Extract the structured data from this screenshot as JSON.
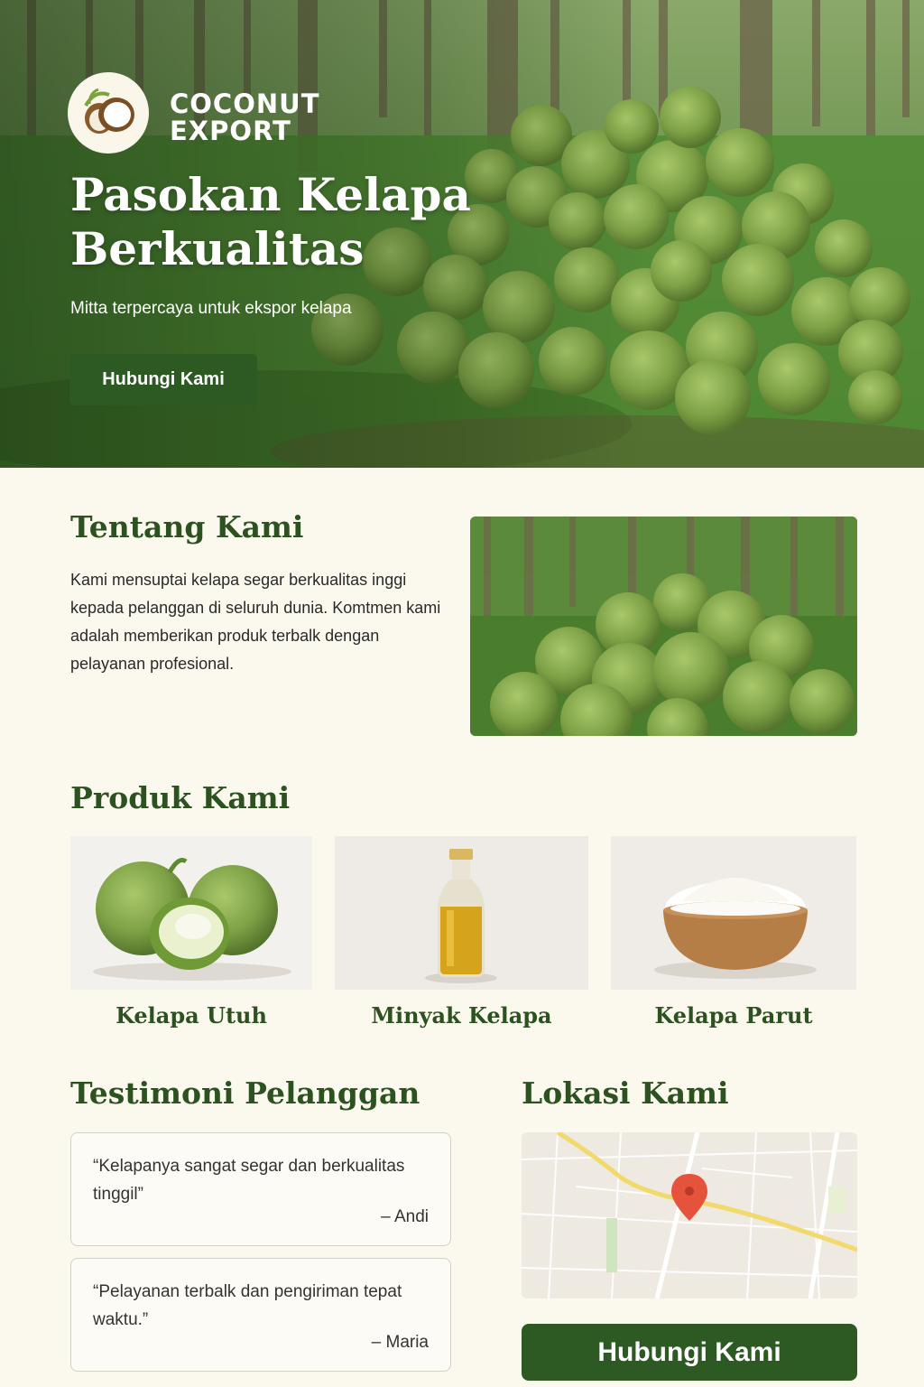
{
  "brand": {
    "line1": "COCONUT",
    "line2": "EXPORT",
    "logo_icon": "coconut-icon"
  },
  "hero": {
    "title_line1": "Pasokan Kelapa",
    "title_line2": "Berkualitas",
    "subtitle": "Mitta terpercaya untuk ekspor kelapa",
    "cta_label": "Hubungi Kami"
  },
  "about": {
    "heading": "Tentang Kami",
    "text": "Kami mensuptai kelapa segar berkualitas inggi kepada pelanggan di seluruh dunia. Komtmen kami adalah memberikan produk terbalk dengan pelayanan profesional."
  },
  "products": {
    "heading": "Produk Kami",
    "items": [
      {
        "name": "Kelapa Utuh"
      },
      {
        "name": "Minyak Kelapa"
      },
      {
        "name": "Kelapa Parut"
      }
    ]
  },
  "testimonials": {
    "heading": "Testimoni Pelanggan",
    "items": [
      {
        "quote": "“Kelapanya sangat segar dan berkualitas tinggil”",
        "author": "– Andi"
      },
      {
        "quote": "“Pelayanan terbalk dan pengiriman tepat waktu.”",
        "author": "– Maria"
      }
    ]
  },
  "location": {
    "heading": "Lokasi Kami",
    "pin_icon": "map-pin-icon",
    "cta_label": "Hubungi Kami"
  },
  "colors": {
    "primary_green": "#2d5a23",
    "heading_green": "#2c5220",
    "page_background": "#fbf8ee",
    "map_pin": "#e5533d",
    "map_road": "#f2d96b"
  }
}
